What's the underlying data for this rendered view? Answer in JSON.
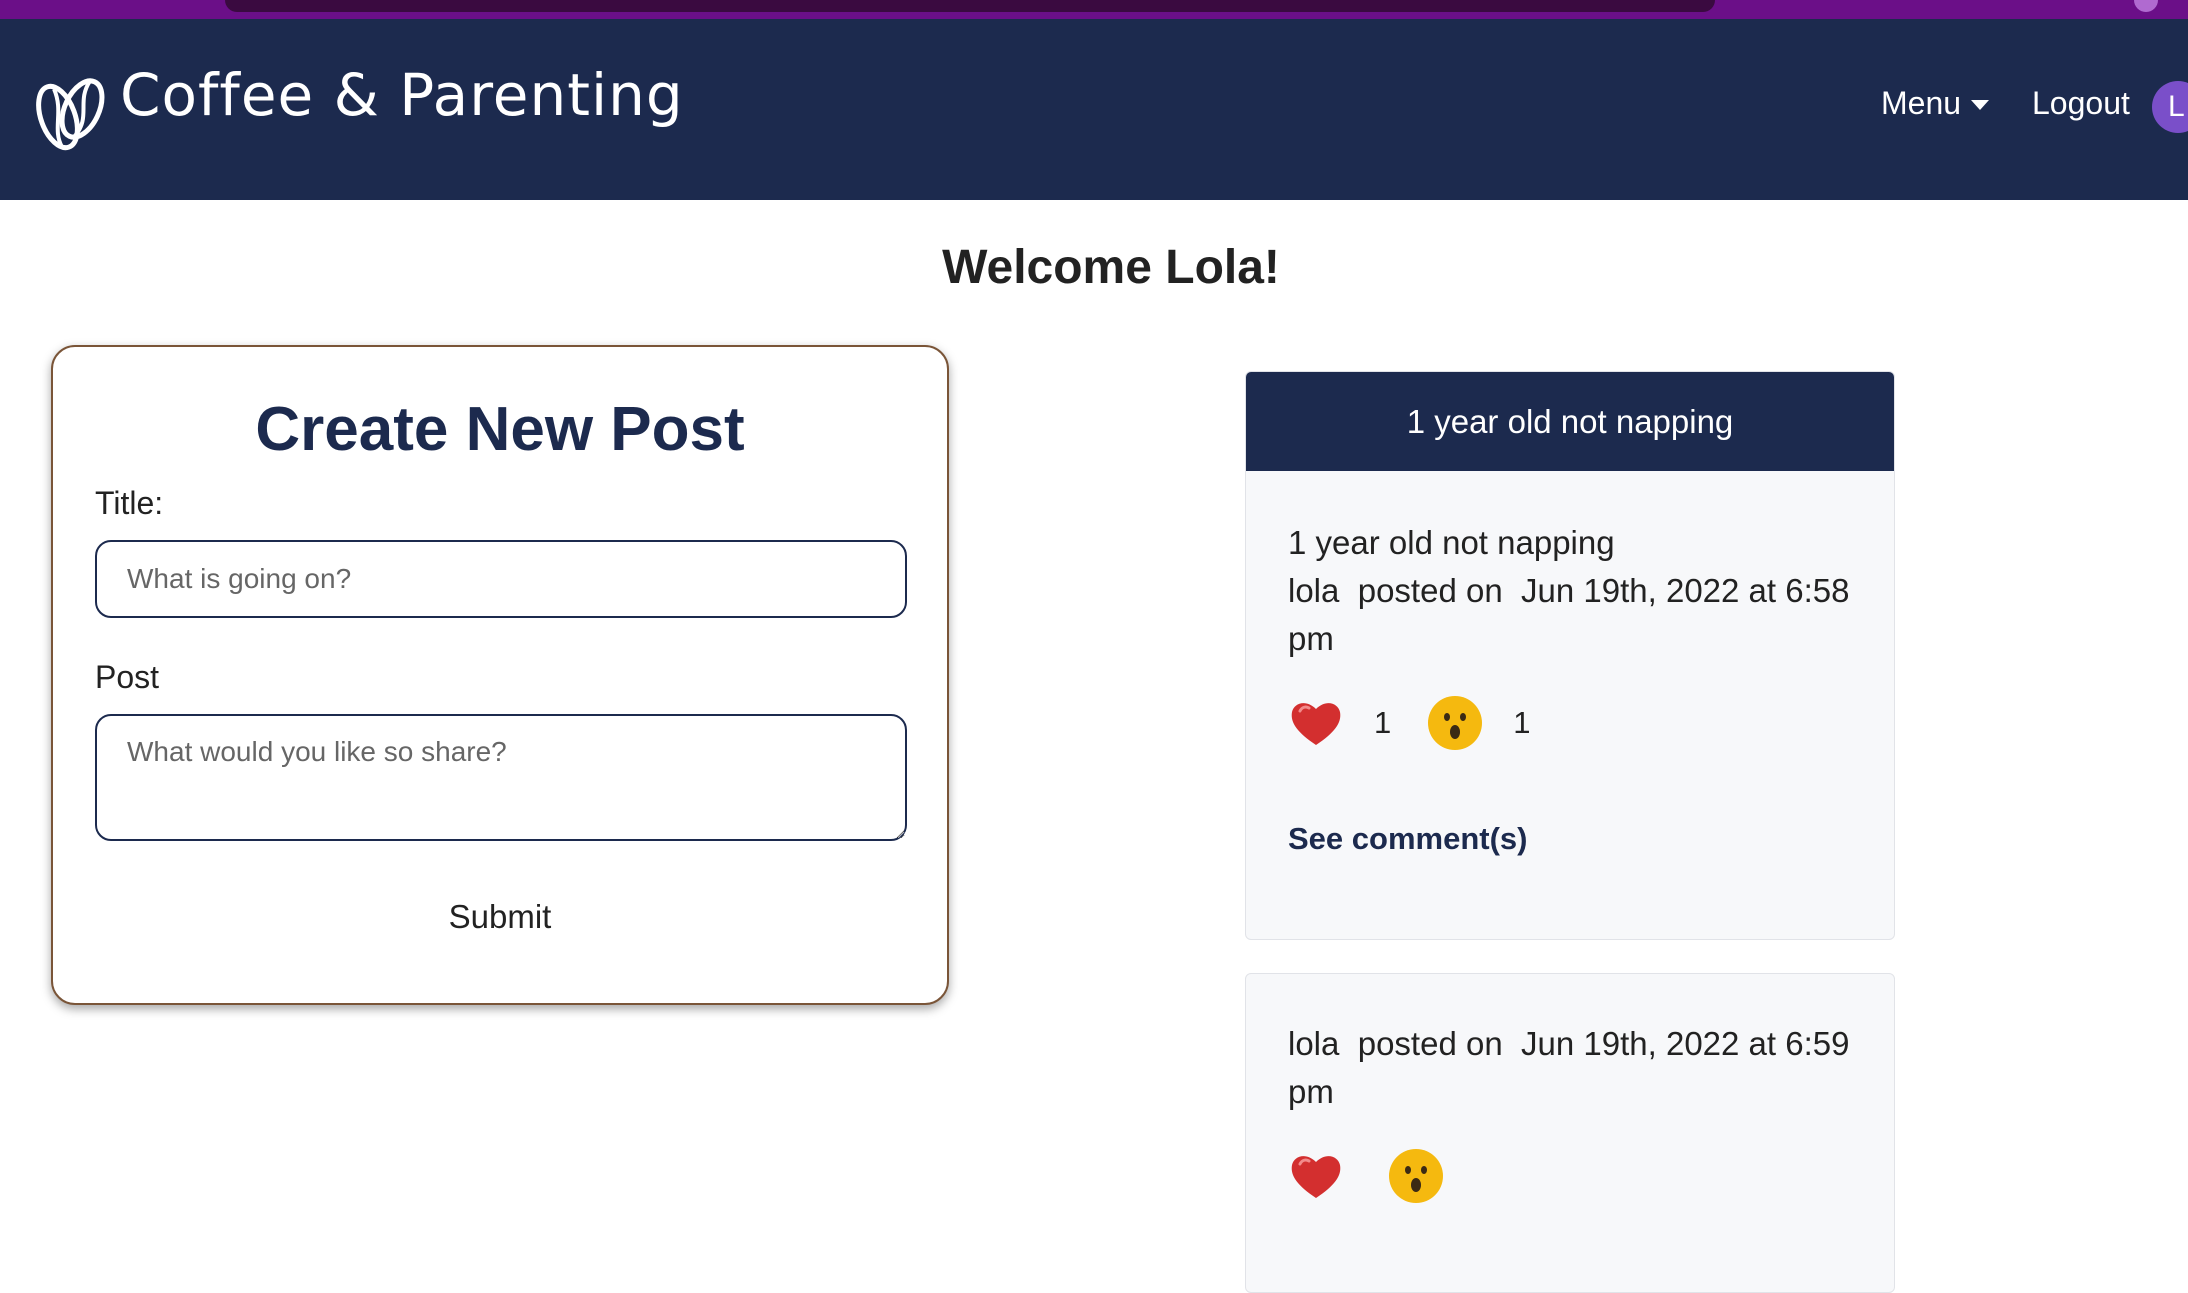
{
  "navbar": {
    "brand": "Coffee & Parenting",
    "menu_label": "Menu",
    "logout_label": "Logout",
    "avatar_initial": "L"
  },
  "welcome": "Welcome Lola!",
  "create_post": {
    "heading": "Create New Post",
    "title_label": "Title:",
    "title_placeholder": "What is going on?",
    "post_label": "Post",
    "post_placeholder": "What would you like so share?",
    "submit_label": "Submit"
  },
  "posts": [
    {
      "header": "1 year old not napping",
      "title": "1 year old not napping",
      "author": "lola",
      "posted_on_label": "posted on",
      "date": "Jun 19th, 2022 at 6:58",
      "time_suffix": "pm",
      "heart_count": "1",
      "surprised_count": "1",
      "see_comments_label": "See comment(s)"
    },
    {
      "author": "lola",
      "posted_on_label": "posted on",
      "date": "Jun 19th, 2022 at 6:59",
      "time_suffix": "pm"
    }
  ],
  "colors": {
    "navy": "#1c2a4e",
    "purple_strip": "#6b0f88",
    "avatar": "#7a4fc9",
    "heart": "#d32f2f",
    "emoji_yellow": "#f5b90f"
  },
  "icons": {
    "brand": "coffee-bean-icon",
    "heart": "heart-icon",
    "surprised": "surprised-face-icon"
  }
}
